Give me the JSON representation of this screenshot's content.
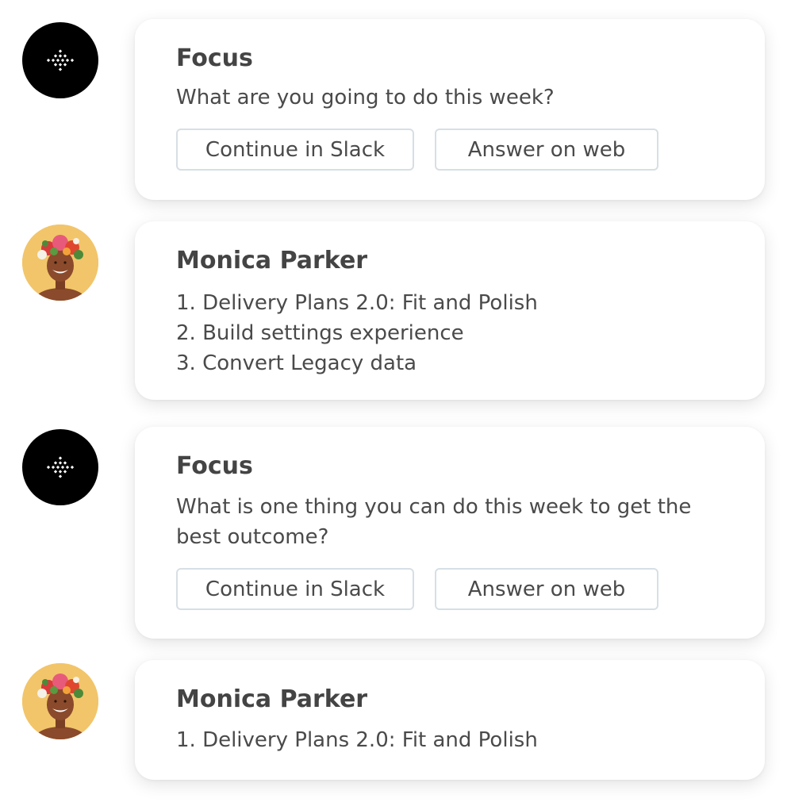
{
  "conversation": [
    {
      "sender": "Focus",
      "question": "What are you going to do this week?",
      "buttons": {
        "slack": "Continue in Slack",
        "web": "Answer on web"
      }
    },
    {
      "sender": "Monica Parker",
      "items": [
        "1. Delivery Plans 2.0: Fit and Polish",
        "2. Build settings experience",
        "3. Convert Legacy data"
      ]
    },
    {
      "sender": "Focus",
      "question": "What is one thing you can do this week to get the best outcome?",
      "buttons": {
        "slack": "Continue in Slack",
        "web": "Answer on web"
      }
    },
    {
      "sender": "Monica Parker",
      "items": [
        "1. Delivery Plans 2.0: Fit and Polish"
      ]
    }
  ],
  "icons": {
    "bot_avatar": "focus-logo-icon",
    "person_avatar": "monica-parker-avatar"
  },
  "colors": {
    "bot_avatar_bg": "#000000",
    "person_avatar_bg": "#f2c56a",
    "button_border": "#d7dfe5",
    "text": "#4a4a4a"
  }
}
